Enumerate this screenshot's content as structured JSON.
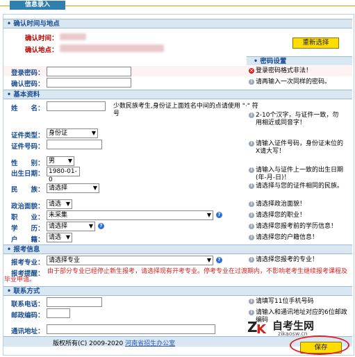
{
  "header": {
    "tab_title": "信息录入"
  },
  "confirm": {
    "section_title": "• 确认时间与地点",
    "time_label": "确认时间：",
    "place_label": "确认地点：",
    "reselect_button": "重新选择"
  },
  "password": {
    "section_title": "• 密码设置",
    "login_label": "登录密码：",
    "confirm_label": "确认密码：",
    "login_error": "登录密码格式非法！",
    "confirm_tip": "请再输入一次同样的密码。"
  },
  "basic": {
    "section_title": "• 基本资料",
    "name_label": "姓　　名：",
    "name_hint": "少数民族考生,身份证上面姓名中间的点请使用 \"·\" 符号",
    "name_tip": "2-10个汉字，与证件一致，勿用相近或同音字！",
    "idtype_label": "证件类型：",
    "idtype_value": "身份证",
    "idno_label": "证件号码：",
    "idno_tip": "请输入证件号码，身份证末位的X请大写！",
    "gender_label": "性　　别：",
    "gender_value": "男",
    "birth_label": "出生日期：",
    "birth_value": "1980-01-0",
    "birth_tip": "请输入与证件上一致的出生日期(年-月-日)！",
    "ethnic_label": "民　　族：",
    "ethnic_value": "请选择",
    "ethnic_tip": "请选择与您的证件相同的民族。",
    "political_label": "政治面貌：",
    "political_value": "请选",
    "political_tip": "请选择政治面貌！",
    "job_label": "职　　业：",
    "job_value": "未采集",
    "job_tip": "请选择您的职业！",
    "edu_label": "学　　历：",
    "edu_value": "请选择",
    "edu_tip": "请选择您报考前的学历信息！",
    "hukou_label": "户　　籍：",
    "hukou_value": "请选",
    "hukou_tip": "请选择您的户籍信息！"
  },
  "exam": {
    "section_title": "• 报考信息",
    "major_label": "报考专业：",
    "major_value": "请选择专业",
    "major_tip": "请选择您报考的专业！",
    "reminder_label": "报考提醒：",
    "reminder_text": "由于部分专业已经停止新生报考，请选择现有开考专业。停考专业在过渡期内，不影响老考生继续报考课程及毕业申请。"
  },
  "contact": {
    "section_title": "• 联系方式",
    "phone_label": "联系电话：",
    "phone_tip": "请填写11位手机号码",
    "postcode_label": "邮政编码：",
    "postcode_tip": "请输入和通讯地址对应的6位邮政编码",
    "address_label": "通讯地址："
  },
  "footer": {
    "copyright": "版权所有(C) 2009-2020",
    "office_link": "河南省招生办公室",
    "save_button": "保存"
  },
  "watermark": {
    "brand": "自考生网",
    "domain": "zikaosw.cn"
  }
}
